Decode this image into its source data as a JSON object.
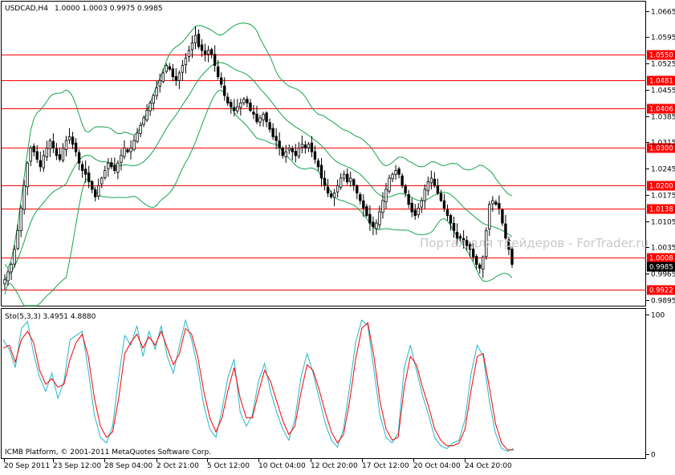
{
  "header": {
    "symbol": "USDCAD,H4",
    "ohlc": "1.0000 1.0003 0.9975 0.9985"
  },
  "watermark": "Портал для трейдеров - ForTrader.ru",
  "footer": "ICMB Platform, © 2001-2011 MetaQuotes Software Corp.",
  "colors": {
    "level_line": "#ff0000",
    "band": "#16a34a",
    "candle": "#000000",
    "sto_main": "#22b8c9",
    "sto_signal": "#ff0000"
  },
  "chart_data": [
    {
      "type": "candlestick",
      "title": "USDCAD,H4",
      "ylim": [
        0.988,
        1.069
      ],
      "y_ticks": [
        "1.0665",
        "1.0595",
        "1.0525",
        "1.0455",
        "1.0385",
        "1.0315",
        "1.0245",
        "1.0175",
        "1.0105",
        "1.0035",
        "0.9965",
        "0.9895"
      ],
      "current_price": "0.9985",
      "horizontal_levels": [
        "1.0550",
        "1.0481",
        "1.0406",
        "1.0300",
        "1.0200",
        "1.0138",
        "1.0008",
        "0.9922"
      ],
      "x_labels": [
        "20 Sep 2011",
        "23 Sep 12:00",
        "28 Sep 04:00",
        "2 Oct 21:00",
        "5 Oct 12:00",
        "10 Oct 04:00",
        "12 Oct 20:00",
        "17 Oct 12:00",
        "20 Oct 04:00",
        "24 Oct 20:00"
      ],
      "close_path": [
        0.995,
        0.997,
        0.999,
        1.003,
        1.008,
        1.014,
        1.02,
        1.026,
        1.03,
        1.029,
        1.027,
        1.025,
        1.028,
        1.03,
        1.032,
        1.03,
        1.028,
        1.027,
        1.03,
        1.032,
        1.033,
        1.031,
        1.029,
        1.026,
        1.024,
        1.023,
        1.021,
        1.019,
        1.017,
        1.02,
        1.022,
        1.024,
        1.026,
        1.025,
        1.024,
        1.026,
        1.028,
        1.03,
        1.029,
        1.03,
        1.032,
        1.034,
        1.036,
        1.038,
        1.04,
        1.042,
        1.044,
        1.046,
        1.048,
        1.05,
        1.052,
        1.051,
        1.049,
        1.048,
        1.05,
        1.052,
        1.054,
        1.056,
        1.058,
        1.06,
        1.057,
        1.056,
        1.055,
        1.056,
        1.055,
        1.052,
        1.049,
        1.047,
        1.044,
        1.042,
        1.041,
        1.04,
        1.041,
        1.042,
        1.043,
        1.042,
        1.04,
        1.039,
        1.037,
        1.038,
        1.039,
        1.037,
        1.035,
        1.033,
        1.032,
        1.03,
        1.028,
        1.029,
        1.03,
        1.029,
        1.028,
        1.03,
        1.031,
        1.03,
        1.031,
        1.029,
        1.027,
        1.025,
        1.022,
        1.02,
        1.018,
        1.017,
        1.018,
        1.02,
        1.022,
        1.023,
        1.021,
        1.022,
        1.02,
        1.018,
        1.016,
        1.014,
        1.012,
        1.01,
        1.009,
        1.01,
        1.013,
        1.016,
        1.019,
        1.022,
        1.023,
        1.024,
        1.023,
        1.02,
        1.018,
        1.015,
        1.013,
        1.012,
        1.014,
        1.016,
        1.019,
        1.021,
        1.022,
        1.02,
        1.018,
        1.016,
        1.014,
        1.012,
        1.01,
        1.008,
        1.006,
        1.006,
        1.005,
        1.004,
        1.003,
        1.001,
        0.999,
        0.998,
        1.001,
        1.008,
        1.015,
        1.016,
        1.015,
        1.014,
        1.01,
        1.006,
        1.003,
        0.999
      ],
      "bb_period": 20,
      "bb_deviation": 2
    },
    {
      "type": "line",
      "title": "Sto(5,3,3) 3.4951 4.8880",
      "ylim": [
        0,
        100
      ],
      "y_ticks": [
        "100",
        "0"
      ],
      "series": [
        {
          "name": "main",
          "values": [
            82,
            75,
            62,
            90,
            95,
            72,
            55,
            45,
            58,
            40,
            52,
            82,
            85,
            88,
            60,
            28,
            12,
            8,
            20,
            55,
            85,
            78,
            92,
            70,
            88,
            75,
            92,
            70,
            58,
            78,
            96,
            82,
            62,
            35,
            18,
            12,
            32,
            55,
            68,
            30,
            20,
            28,
            52,
            65,
            45,
            30,
            18,
            10,
            25,
            55,
            72,
            58,
            40,
            22,
            10,
            5,
            18,
            48,
            80,
            96,
            92,
            60,
            28,
            12,
            8,
            15,
            62,
            78,
            60,
            42,
            28,
            12,
            6,
            4,
            8,
            10,
            25,
            58,
            78,
            70,
            38,
            15,
            4,
            2,
            4
          ]
        },
        {
          "name": "signal",
          "values": [
            76,
            78,
            66,
            82,
            88,
            80,
            60,
            50,
            54,
            48,
            50,
            68,
            80,
            86,
            70,
            40,
            20,
            12,
            16,
            40,
            72,
            80,
            86,
            76,
            84,
            78,
            88,
            76,
            64,
            72,
            90,
            86,
            70,
            45,
            26,
            16,
            26,
            46,
            62,
            40,
            26,
            26,
            44,
            60,
            52,
            38,
            24,
            14,
            20,
            44,
            64,
            60,
            46,
            30,
            16,
            8,
            14,
            38,
            68,
            90,
            94,
            70,
            38,
            18,
            10,
            12,
            48,
            70,
            64,
            48,
            34,
            18,
            10,
            6,
            6,
            8,
            18,
            46,
            70,
            72,
            48,
            22,
            8,
            3,
            3
          ]
        }
      ]
    }
  ]
}
